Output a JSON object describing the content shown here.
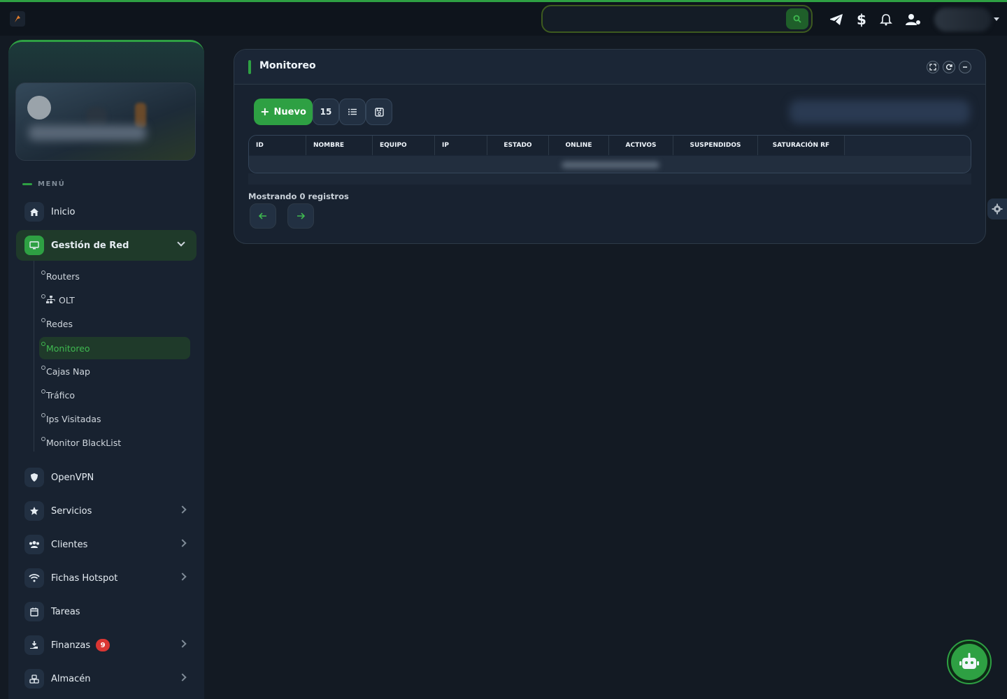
{
  "colors": {
    "accent": "#2ea043",
    "background": "#131a23",
    "panel": "#182230",
    "badge": "#da3633"
  },
  "topbar": {
    "search": {
      "placeholder": "",
      "icon": "search-icon"
    },
    "icons": [
      "telegram-icon",
      "dollar-icon",
      "bell-icon",
      "user-cog-icon"
    ]
  },
  "sidebar": {
    "menu_heading": "MENÚ",
    "items": [
      {
        "label": "Inicio",
        "icon": "home-icon"
      },
      {
        "label": "Gestión de Red",
        "icon": "network-icon",
        "expanded": true
      },
      {
        "label": "OpenVPN",
        "icon": "shield-icon"
      },
      {
        "label": "Servicios",
        "icon": "star-icon"
      },
      {
        "label": "Clientes",
        "icon": "users-icon"
      },
      {
        "label": "Fichas Hotspot",
        "icon": "wifi-icon"
      },
      {
        "label": "Tareas",
        "icon": "calendar-icon"
      },
      {
        "label": "Finanzas",
        "icon": "hand-money-icon",
        "badge": "9"
      },
      {
        "label": "Almacén",
        "icon": "boxes-icon"
      }
    ],
    "subitems": [
      {
        "label": "Routers"
      },
      {
        "label": "OLT",
        "icon": "sitemap-icon"
      },
      {
        "label": "Redes"
      },
      {
        "label": "Monitoreo",
        "selected": true
      },
      {
        "label": "Cajas Nap"
      },
      {
        "label": "Tráfico"
      },
      {
        "label": "Ips Visitadas"
      },
      {
        "label": "Monitor BlackList"
      }
    ]
  },
  "card": {
    "title": "Monitoreo",
    "header_icons": [
      "fullscreen-icon",
      "refresh-icon",
      "collapse-icon"
    ],
    "new_button": "Nuevo",
    "page_size": "15",
    "columns": [
      "ID",
      "NOMBRE",
      "EQUIPO",
      "IP",
      "ESTADO",
      "ONLINE",
      "ACTIVOS",
      "SUSPENDIDOS",
      "SATURACIÓN RF"
    ],
    "footer_text": "Mostrando 0 registros"
  }
}
